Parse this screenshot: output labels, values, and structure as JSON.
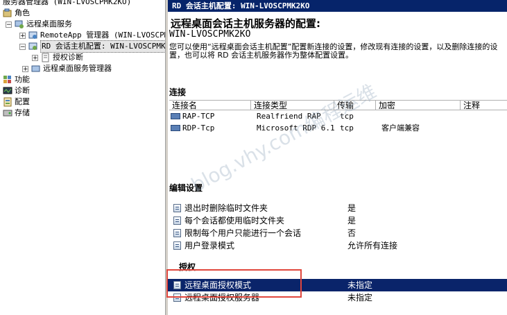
{
  "tree": {
    "root": "服务器管理器 (WIN-LVOSCPMK2KO)",
    "roles": "角色",
    "rds": "远程桌面服务",
    "remoteapp": "RemoteApp 管理器 (WIN-LVOSCPM",
    "rd_config": "RD 会话主机配置: WIN-LVOSCPMK",
    "licensing_diag": "授权诊断",
    "rds_manager": "远程桌面服务管理器",
    "features": "功能",
    "diagnostics": "诊断",
    "configuration": "配置",
    "storage": "存储"
  },
  "right": {
    "header": "RD 会话主机配置: WIN-LVOSCPMK2KO",
    "heading": "远程桌面会话主机服务器的配置:",
    "server": "WIN-LVOSCPMK2KO",
    "description": "您可以使用“远程桌面会话主机配置”配置新连接的设置，修改现有连接的设置，以及删除连接的设置，也可以将 RD 会话主机服务器作为整体配置设置。",
    "connections_title": "连接",
    "columns": [
      "连接名",
      "连接类型",
      "传输",
      "加密",
      "注释"
    ],
    "connections": [
      {
        "name": "RAP-TCP",
        "type": "Realfriend RAP",
        "transport": "tcp",
        "encryption": "",
        "comment": ""
      },
      {
        "name": "RDP-Tcp",
        "type": "Microsoft RDP 6.1",
        "transport": "tcp",
        "encryption": "客户端兼容",
        "comment": ""
      }
    ],
    "edit_settings_title": "编辑设置",
    "general_settings": [
      {
        "name": "退出时删除临时文件夹",
        "value": "是"
      },
      {
        "name": "每个会话都使用临时文件夹",
        "value": "是"
      },
      {
        "name": "限制每个用户只能进行一个会话",
        "value": "否"
      },
      {
        "name": "用户登录模式",
        "value": "允许所有连接"
      }
    ],
    "licensing_title": "授权",
    "licensing_settings": [
      {
        "name": "远程桌面授权模式",
        "value": "未指定"
      },
      {
        "name": "远程桌面授权服务器",
        "value": "未指定"
      }
    ],
    "watermark": "blog.vhy.com编程运维"
  },
  "colors": {
    "header_bg": "#06246a",
    "selection": "#0a246a",
    "highlight_box": "#e0463c"
  },
  "icons": [
    "server-manager-icon",
    "roles-icon",
    "rds-icon",
    "remoteapp-icon",
    "rd-config-icon",
    "diagnostics-icon",
    "features-icon",
    "configuration-icon",
    "storage-icon",
    "network-connection-icon",
    "setting-icon"
  ]
}
